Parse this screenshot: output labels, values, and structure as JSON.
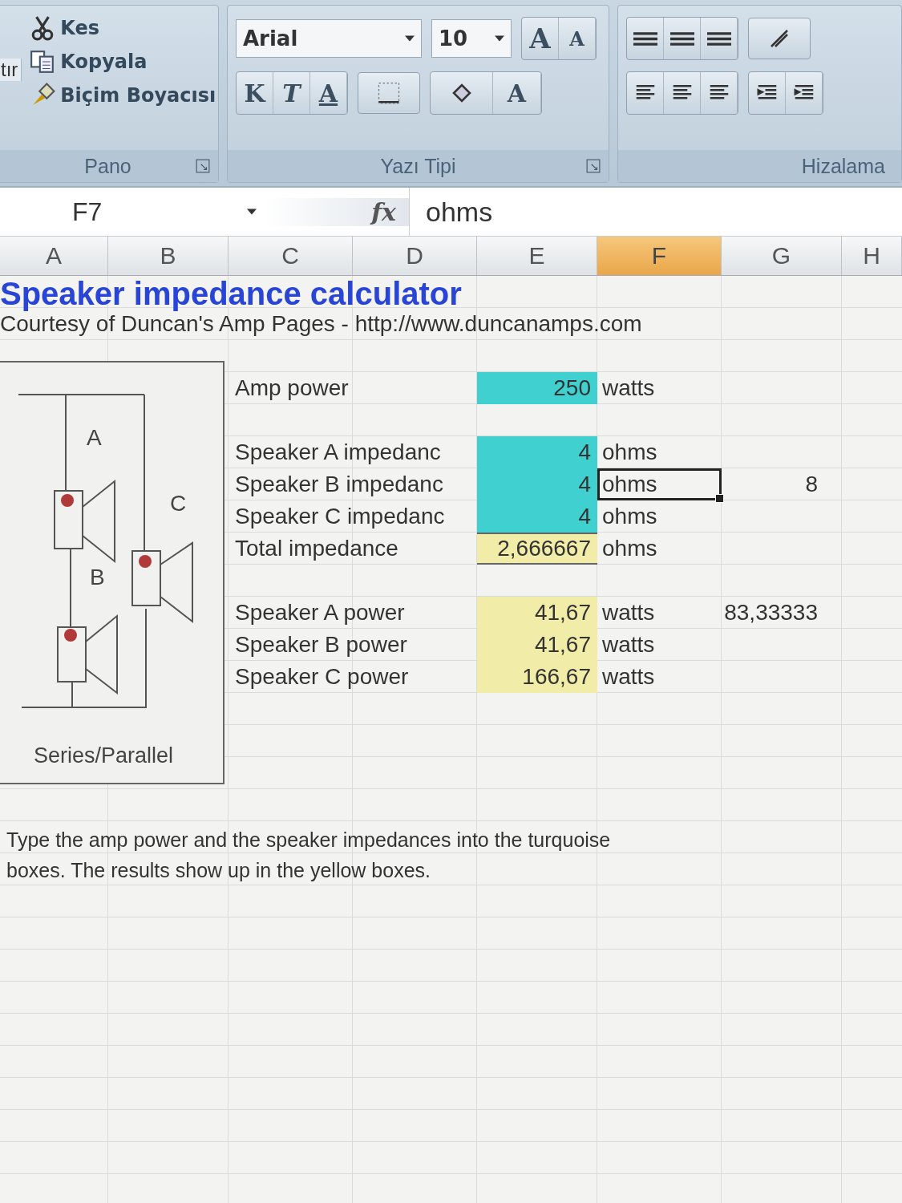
{
  "ribbon": {
    "clipboard": {
      "cut_label": "tır",
      "items": [
        {
          "kind": "cut",
          "label": "Kes"
        },
        {
          "kind": "copy",
          "label": "Kopyala"
        },
        {
          "kind": "brush",
          "label": "Biçim Boyacısı"
        }
      ],
      "group_label": "Pano"
    },
    "font": {
      "family": "Arial",
      "size": "10",
      "grow_label": "A",
      "shrink_label": "A",
      "format_buttons": [
        {
          "kind": "bold",
          "label": "K"
        },
        {
          "kind": "italic",
          "label": "T"
        },
        {
          "kind": "underline",
          "label": "A"
        }
      ],
      "color_label": "A",
      "group_label": "Yazı Tipi"
    },
    "alignment": {
      "group_label": "Hizalama"
    }
  },
  "formula_bar": {
    "cell_ref": "F7",
    "function_label": "fx",
    "value": "ohms"
  },
  "columns": [
    {
      "label": "A",
      "selected": false
    },
    {
      "label": "B",
      "selected": false
    },
    {
      "label": "C",
      "selected": false
    },
    {
      "label": "D",
      "selected": false
    },
    {
      "label": "E",
      "selected": false
    },
    {
      "label": "F",
      "selected": true
    },
    {
      "label": "G",
      "selected": false
    },
    {
      "label": "H",
      "selected": false
    }
  ],
  "title": "Speaker impedance calculator",
  "subtitle": "Courtesy of Duncan's Amp Pages - http://www.duncanamps.com",
  "diagram": {
    "labels": [
      "A",
      "B",
      "C"
    ],
    "caption": "Series/Parallel"
  },
  "groups": [
    [
      {
        "label": "Amp power",
        "value": "250",
        "kind": "input",
        "unit": "watts",
        "selected": false
      }
    ],
    [
      {
        "label": "Speaker A impedanc",
        "value": "4",
        "kind": "input",
        "unit": "ohms",
        "selected": false
      },
      {
        "label": "Speaker B impedanc",
        "value": "4",
        "kind": "input",
        "unit": "ohms",
        "selected": true,
        "extra": "8"
      },
      {
        "label": "Speaker C impedanc",
        "value": "4",
        "kind": "input",
        "unit": "ohms",
        "selected": false
      },
      {
        "label": "Total impedance",
        "value": "2,666667",
        "kind": "total",
        "unit": "ohms",
        "selected": false
      }
    ],
    [
      {
        "label": "Speaker A power",
        "value": "41,67",
        "kind": "result",
        "unit": "watts",
        "selected": false,
        "extra": "83,33333"
      },
      {
        "label": "Speaker B power",
        "value": "41,67",
        "kind": "result",
        "unit": "watts",
        "selected": false
      },
      {
        "label": "Speaker C power",
        "value": "166,67",
        "kind": "result",
        "unit": "watts",
        "selected": false
      }
    ]
  ],
  "note": "Type the amp power and the speaker impedances into the turquoise boxes.  The results show up in the yellow boxes."
}
